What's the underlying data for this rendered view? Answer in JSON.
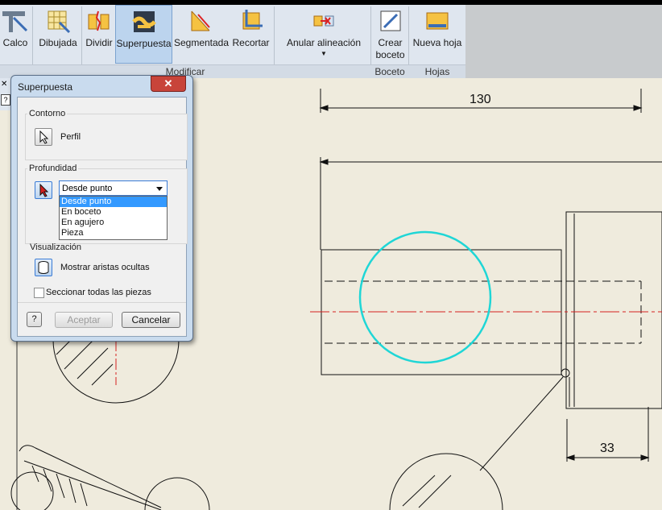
{
  "ribbon": {
    "buttons": [
      {
        "label": "Calco",
        "icon": "calco-icon"
      },
      {
        "label": "Dibujada",
        "icon": "dibujada-icon"
      },
      {
        "label": "Dividir",
        "icon": "dividir-icon"
      },
      {
        "label": "Superpuesta",
        "icon": "superpuesta-icon"
      },
      {
        "label": "Segmentada",
        "icon": "segmentada-icon"
      },
      {
        "label": "Recortar",
        "icon": "recortar-icon"
      },
      {
        "label": "Anular alineación",
        "icon": "anular-alineacion-icon"
      },
      {
        "label": "Crear boceto",
        "icon": "crear-boceto-icon"
      },
      {
        "label": "Nueva hoja",
        "icon": "nueva-hoja-icon"
      }
    ],
    "groups": {
      "modificar": "Modificar",
      "boceto": "Boceto",
      "hojas": "Hojas"
    }
  },
  "dialog": {
    "title": "Superpuesta",
    "close": "✕",
    "contorno": {
      "label": "Contorno",
      "perfil": "Perfil"
    },
    "profundidad": {
      "label": "Profundidad",
      "selected": "Desde punto",
      "options": [
        "Desde punto",
        "En boceto",
        "En agujero",
        "Pieza"
      ]
    },
    "visualizacion": {
      "label": "Visualización",
      "mostrar": "Mostrar aristas ocultas",
      "seccionar": "Seccionar todas las piezas",
      "seccionar_checked": false
    },
    "help": "?",
    "aceptar": "Aceptar",
    "cancelar": "Cancelar"
  },
  "drawing": {
    "dim_top": "130",
    "dim_bottom": "33",
    "colors": {
      "circle": "#1fd6d6",
      "centerline": "#d42020",
      "paper": "#efebdd"
    }
  }
}
